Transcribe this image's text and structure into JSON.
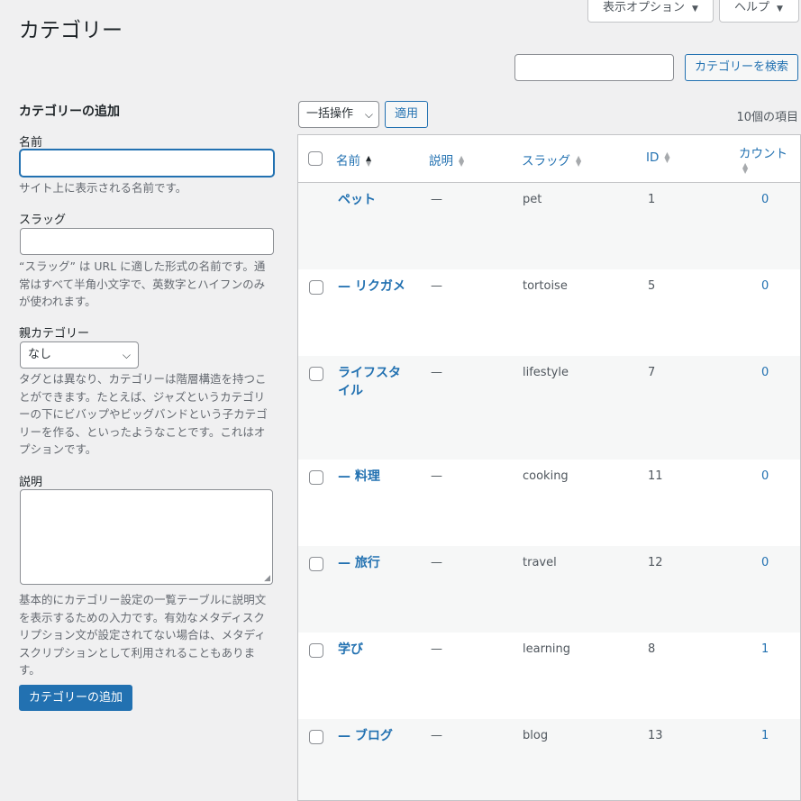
{
  "screen_options": {
    "display_label": "表示オプション",
    "help_label": "ヘルプ",
    "arrow": "▼"
  },
  "page_title": "カテゴリー",
  "search": {
    "value": "",
    "button_label": "カテゴリーを検索"
  },
  "form": {
    "heading": "カテゴリーの追加",
    "name_label": "名前",
    "name_value": "",
    "name_help": "サイト上に表示される名前です。",
    "slug_label": "スラッグ",
    "slug_value": "",
    "slug_help": "“スラッグ” は URL に適した形式の名前です。通常はすべて半角小文字で、英数字とハイフンのみが使われます。",
    "parent_label": "親カテゴリー",
    "parent_selected": "なし",
    "parent_help": "タグとは異なり、カテゴリーは階層構造を持つことができます。たとえば、ジャズというカテゴリーの下にビバップやビッグバンドという子カテゴリーを作る、といったようなことです。これはオプションです。",
    "description_label": "説明",
    "description_value": "",
    "description_help": "基本的にカテゴリー設定の一覧テーブルに説明文を表示するための入力です。有効なメタディスクリプション文が設定されてない場合は、メタディスクリプションとして利用されることもあります。",
    "submit_label": "カテゴリーの追加"
  },
  "toolbar": {
    "bulk_label": "一括操作",
    "apply_label": "適用",
    "items_count": "10個の項目"
  },
  "table": {
    "columns": {
      "name": "名前",
      "description": "説明",
      "slug": "スラッグ",
      "id": "ID",
      "count": "カウント"
    },
    "rows": [
      {
        "name": "ペット",
        "description": "—",
        "slug": "pet",
        "id": "1",
        "count": "0",
        "checkbox": false
      },
      {
        "name": "— リクガメ",
        "description": "—",
        "slug": "tortoise",
        "id": "5",
        "count": "0",
        "checkbox": true
      },
      {
        "name": "ライフスタイル",
        "description": "—",
        "slug": "lifestyle",
        "id": "7",
        "count": "0",
        "checkbox": true
      },
      {
        "name": "— 料理",
        "description": "—",
        "slug": "cooking",
        "id": "11",
        "count": "0",
        "checkbox": true
      },
      {
        "name": "— 旅行",
        "description": "—",
        "slug": "travel",
        "id": "12",
        "count": "0",
        "checkbox": true
      },
      {
        "name": "学び",
        "description": "—",
        "slug": "learning",
        "id": "8",
        "count": "1",
        "checkbox": true
      },
      {
        "name": "— ブログ",
        "description": "—",
        "slug": "blog",
        "id": "13",
        "count": "1",
        "checkbox": true
      }
    ]
  }
}
